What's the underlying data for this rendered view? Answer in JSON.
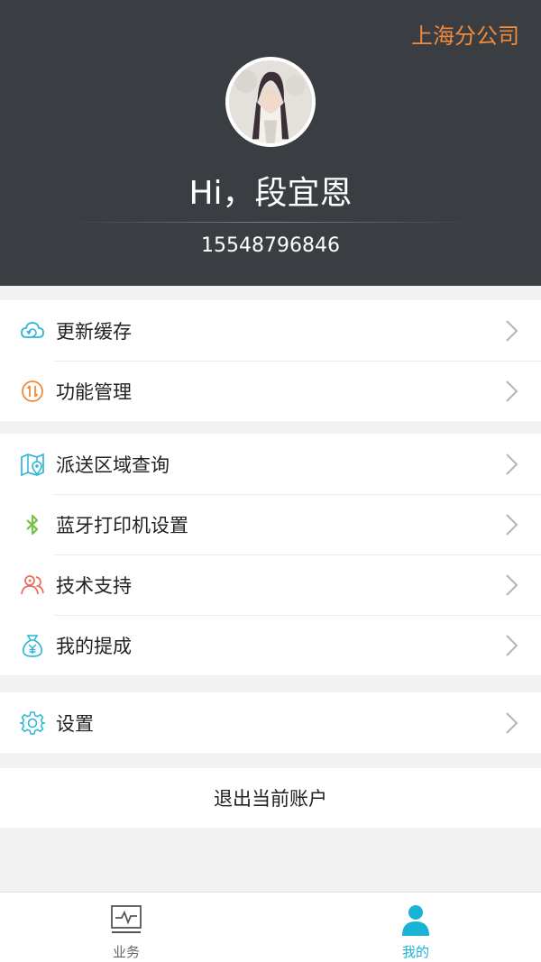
{
  "header": {
    "branch": "上海分公司",
    "greeting": "Hi，段宜恩",
    "phone": "15548796846"
  },
  "menu_group_1": [
    {
      "label": "更新缓存",
      "icon": "cloud-refresh-icon",
      "color": "#2eb6d8"
    },
    {
      "label": "功能管理",
      "icon": "swap-circle-icon",
      "color": "#f08a3c"
    }
  ],
  "menu_group_2": [
    {
      "label": "派送区域查询",
      "icon": "map-pin-icon",
      "color": "#2eb6d8"
    },
    {
      "label": "蓝牙打印机设置",
      "icon": "bluetooth-icon",
      "color": "#7cc247"
    },
    {
      "label": "技术支持",
      "icon": "support-people-icon",
      "color": "#ee6a5a"
    },
    {
      "label": "我的提成",
      "icon": "money-bag-icon",
      "color": "#2eb6d8"
    }
  ],
  "menu_group_3": [
    {
      "label": "设置",
      "icon": "gear-icon",
      "color": "#2eb6d8"
    }
  ],
  "logout_label": "退出当前账户",
  "tabbar": {
    "tabs": [
      {
        "label": "业务",
        "icon": "activity-monitor-icon",
        "active": false
      },
      {
        "label": "我的",
        "icon": "user-icon",
        "active": true
      }
    ],
    "active_color": "#19b3d6",
    "inactive_color": "#666666"
  }
}
